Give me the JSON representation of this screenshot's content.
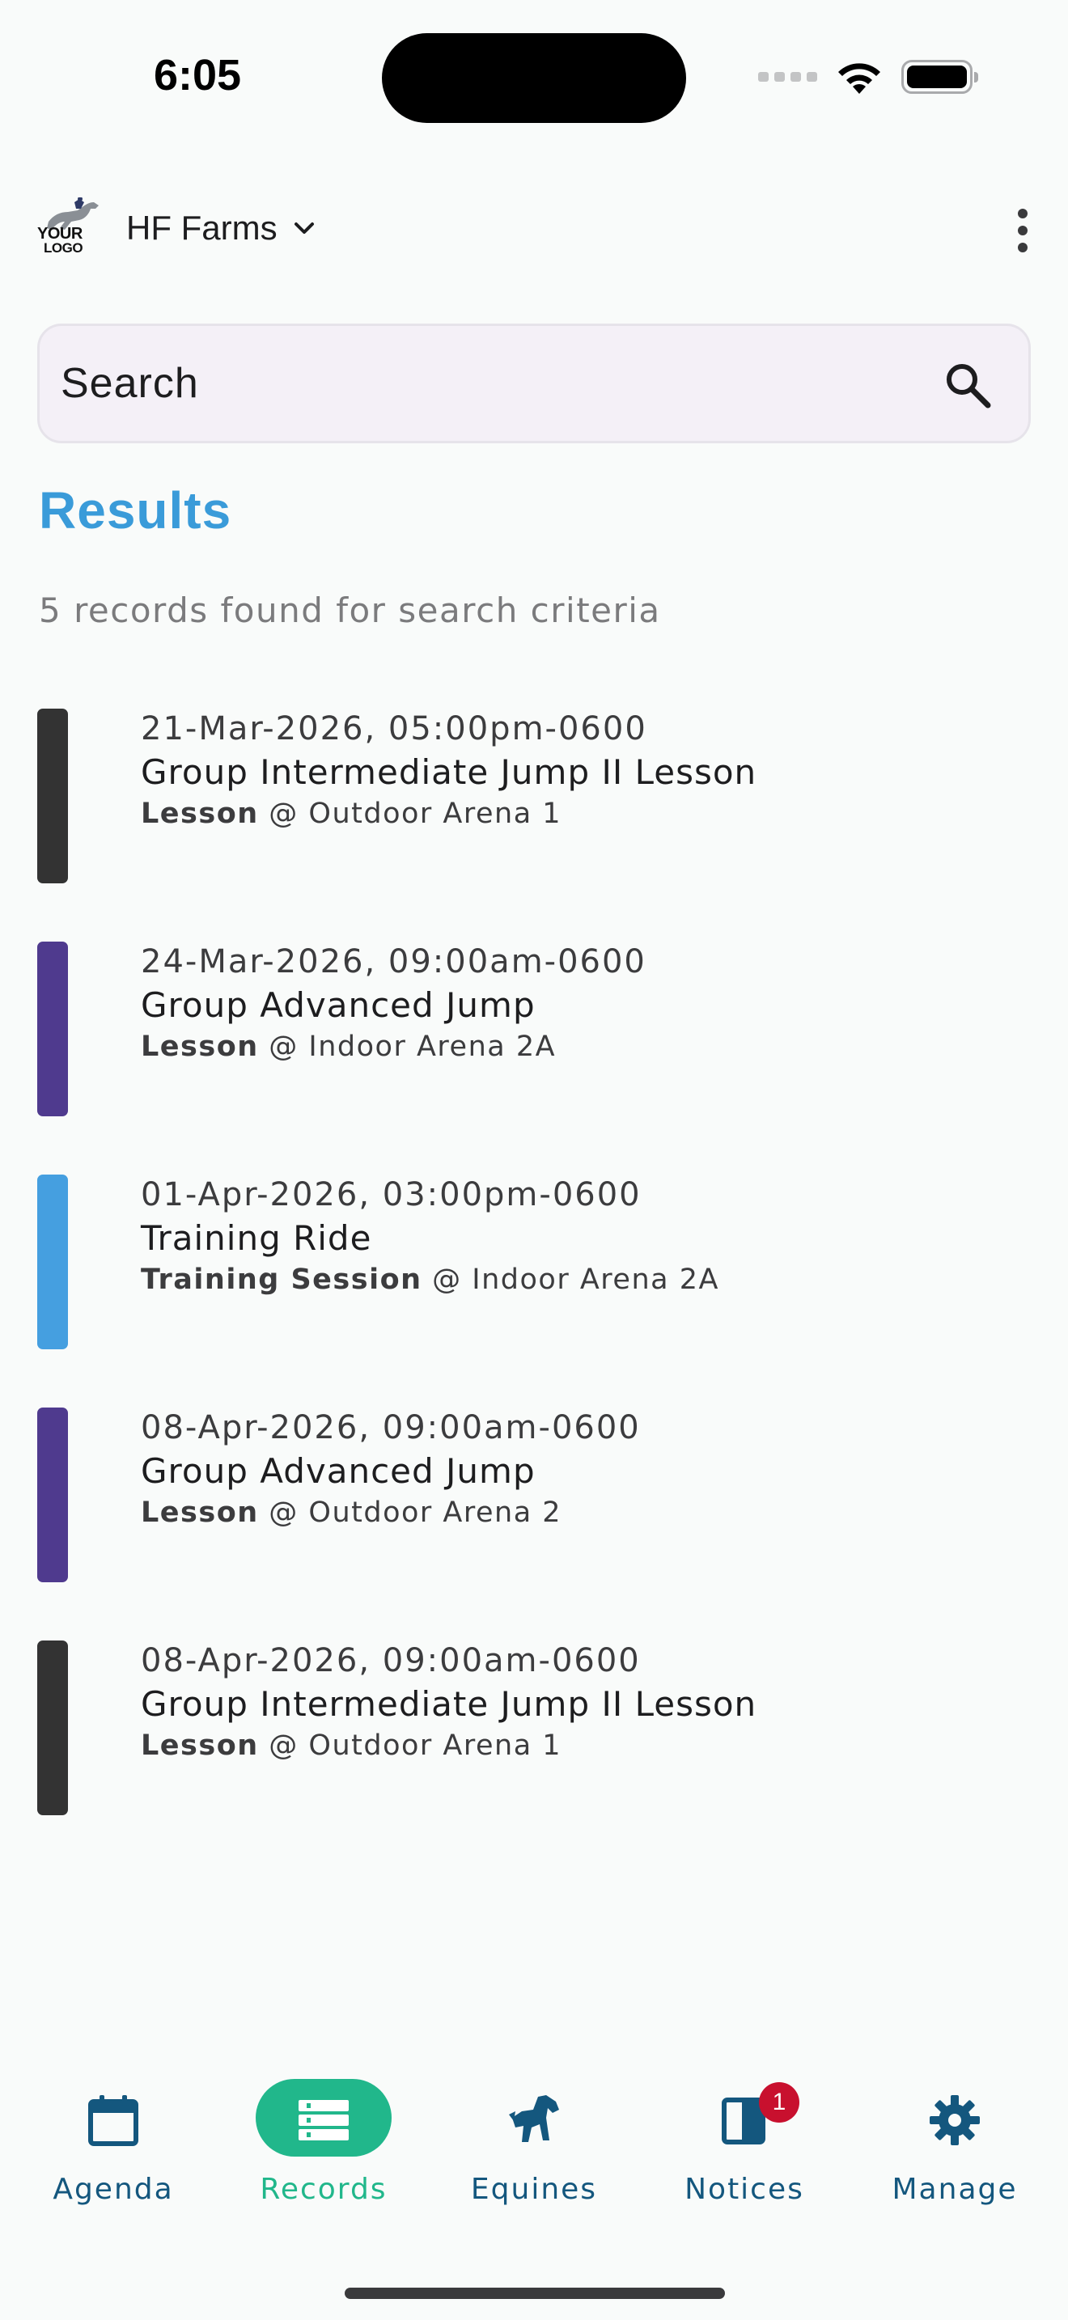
{
  "status_bar": {
    "time": "6:05"
  },
  "header": {
    "logo_text_line1": "YOUR",
    "logo_text_line2": "LOGO",
    "farm_name": "HF Farms"
  },
  "search": {
    "placeholder": "Search"
  },
  "results": {
    "title": "Results",
    "count_text": "5 records found for search criteria",
    "records": [
      {
        "date": "21-Mar-2026, 05:00pm-0600",
        "title": "Group Intermediate Jump II Lesson",
        "type": "Lesson",
        "location": " @ Outdoor Arena 1",
        "color": "#333333"
      },
      {
        "date": "24-Mar-2026, 09:00am-0600",
        "title": "Group Advanced Jump",
        "type": "Lesson",
        "location": " @ Indoor Arena 2A",
        "color": "#4f3a8e"
      },
      {
        "date": "01-Apr-2026, 03:00pm-0600",
        "title": "Training Ride",
        "type": "Training Session",
        "location": " @ Indoor Arena 2A",
        "color": "#459fe0"
      },
      {
        "date": "08-Apr-2026, 09:00am-0600",
        "title": "Group Advanced Jump",
        "type": "Lesson",
        "location": " @ Outdoor Arena 2",
        "color": "#4f3a8e"
      },
      {
        "date": "08-Apr-2026, 09:00am-0600",
        "title": "Group Intermediate Jump II Lesson",
        "type": "Lesson",
        "location": " @ Outdoor Arena 1",
        "color": "#333333"
      }
    ]
  },
  "nav": {
    "items": [
      {
        "label": "Agenda",
        "icon": "calendar-icon"
      },
      {
        "label": "Records",
        "icon": "list-icon",
        "active": true
      },
      {
        "label": "Equines",
        "icon": "horse-icon"
      },
      {
        "label": "Notices",
        "icon": "notice-icon",
        "badge": "1"
      },
      {
        "label": "Manage",
        "icon": "gear-icon"
      }
    ]
  },
  "colors": {
    "accent": "#3a9bd9",
    "active": "#21b78b",
    "nav_text": "#14577e",
    "badge": "#c8102e"
  }
}
